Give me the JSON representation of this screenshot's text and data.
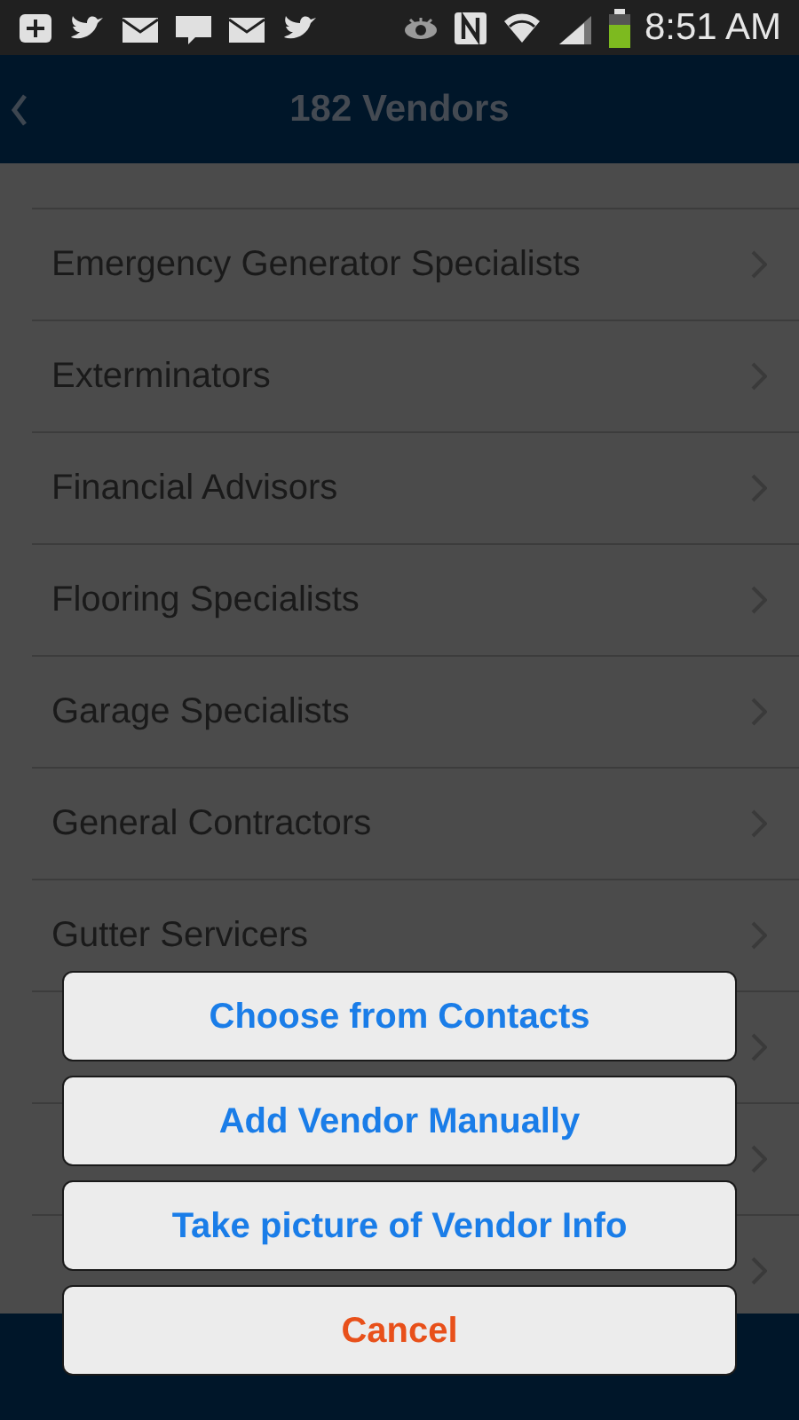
{
  "status_bar": {
    "time": "8:51 AM"
  },
  "header": {
    "title": "182 Vendors"
  },
  "vendors": [
    {
      "name": "Emergency Generator Specialists"
    },
    {
      "name": "Exterminators"
    },
    {
      "name": "Financial Advisors"
    },
    {
      "name": "Flooring Specialists"
    },
    {
      "name": "Garage Specialists"
    },
    {
      "name": "General Contractors"
    },
    {
      "name": "Gutter Servicers"
    }
  ],
  "action_sheet": [
    {
      "label": "Choose from Contacts",
      "kind": "action"
    },
    {
      "label": "Add Vendor Manually",
      "kind": "action"
    },
    {
      "label": "Take picture of Vendor Info",
      "kind": "action"
    },
    {
      "label": "Cancel",
      "kind": "cancel"
    }
  ]
}
